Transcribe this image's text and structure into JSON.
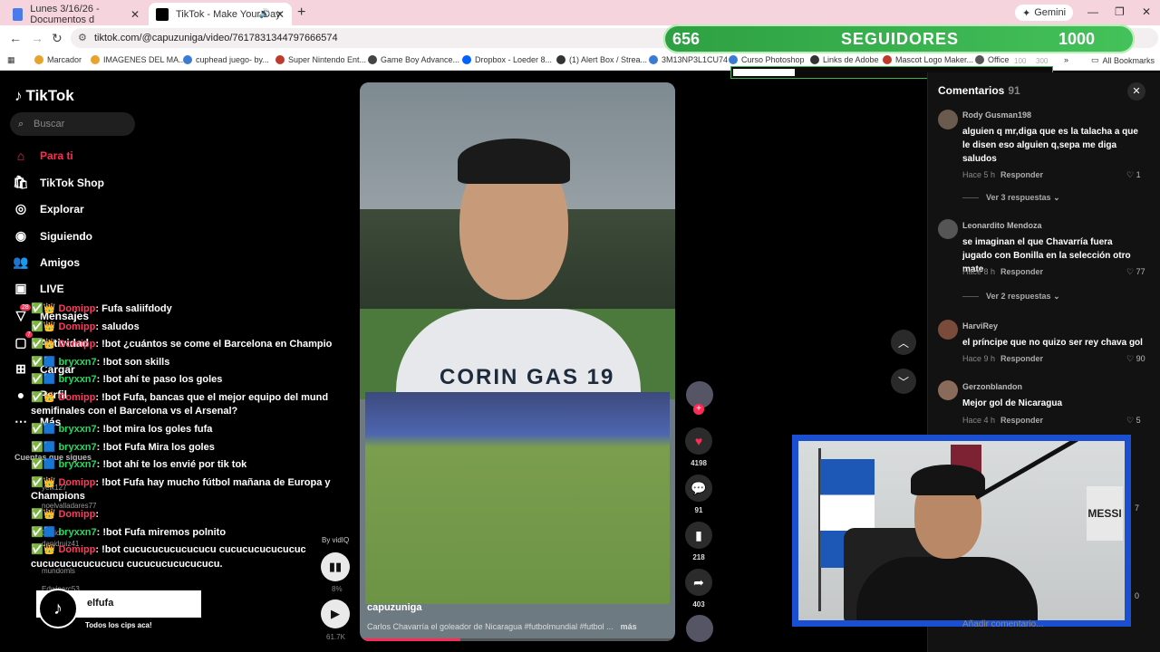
{
  "browser": {
    "tabs": [
      {
        "title": "Lunes 3/16/26 - Documentos d",
        "active": false
      },
      {
        "title": "TikTok - Make Your Day",
        "active": true
      }
    ],
    "gemini": "Gemini",
    "url": "tiktok.com/@capuzuniga/video/7617831344797666574",
    "bookmarks": [
      "Marcador",
      "IMAGENES DEL MA...",
      "cuphead juego- by...",
      "Super Nintendo Ent...",
      "Game Boy Advance...",
      "Dropbox - Loeder 8...",
      "(1) Alert Box / Strea...",
      "3M13NP3L1CU74",
      "Curso Photoshop",
      "Links de Adobe",
      "Mascot Logo Maker...",
      "Office",
      "All Bookmarks"
    ]
  },
  "follower_goal": {
    "current": "656",
    "label": "SEGUIDORES",
    "goal": "1000",
    "sub_left": "100",
    "sub_right": "300"
  },
  "tiktok": {
    "logo": "TikTok",
    "search_placeholder": "Buscar",
    "nav": [
      {
        "label": "Para ti",
        "icon": "home-icon",
        "active": true
      },
      {
        "label": "TikTok Shop",
        "icon": "shop-icon"
      },
      {
        "label": "Explorar",
        "icon": "compass-icon"
      },
      {
        "label": "Siguiendo",
        "icon": "following-icon"
      },
      {
        "label": "Amigos",
        "icon": "friends-icon"
      },
      {
        "label": "LIVE",
        "icon": "live-icon"
      },
      {
        "label": "Mensajes",
        "icon": "messages-icon"
      },
      {
        "label": "Actividad",
        "icon": "activity-icon"
      },
      {
        "label": "Cargar",
        "icon": "upload-icon"
      },
      {
        "label": "Perfil",
        "icon": "profile-icon"
      },
      {
        "label": "Más",
        "icon": "more-icon"
      }
    ],
    "following_header": "Cuentas que sigues",
    "following": [
      "yeik127",
      "noelvalladares77",
      "David",
      "danidruiz41",
      "mundomls",
      "Edwinarc53"
    ],
    "badge_messages": "28",
    "badge_activity": "7"
  },
  "chat": [
    {
      "user": "Domipp",
      "color": "red",
      "text": ": Fufa saliifdody"
    },
    {
      "user": "Domipp",
      "color": "red",
      "text": ": saludos"
    },
    {
      "user": "Domipp",
      "color": "red",
      "text": ": !bot ¿cuántos se come el Barcelona en Champio"
    },
    {
      "user": "bryxxn7",
      "color": "green",
      "text": ": !bot son skills"
    },
    {
      "user": "bryxxn7",
      "color": "green",
      "text": ": !bot ahí te paso los goles"
    },
    {
      "user": "Domipp",
      "color": "red",
      "text": ": !bot Fufa, bancas que el mejor equipo del mund"
    },
    {
      "user": "",
      "color": "none",
      "text": "semifinales con el Barcelona vs el Arsenal?"
    },
    {
      "user": "bryxxn7",
      "color": "green",
      "text": ": !bot mira los goles fufa"
    },
    {
      "user": "bryxxn7",
      "color": "green",
      "text": ": !bot Fufa Mira los goles"
    },
    {
      "user": "bryxxn7",
      "color": "green",
      "text": ": !bot ahí te los envié por tik tok"
    },
    {
      "user": "Domipp",
      "color": "red",
      "text": ": !bot Fufa hay mucho fútbol mañana de Europa y"
    },
    {
      "user": "",
      "color": "none",
      "text": "Champions"
    },
    {
      "user": "Domipp",
      "color": "red",
      "text": ":"
    },
    {
      "user": "bryxxn7",
      "color": "green",
      "text": ": !bot Fufa miremos polnito"
    },
    {
      "user": "Domipp",
      "color": "red",
      "text": ": !bot cucucucucucucucu cucucucucucucuc"
    },
    {
      "user": "",
      "color": "none",
      "text": "cucucucucucucucu cucucucucucucucu."
    }
  ],
  "video": {
    "jersey": "CORIN GAS 19",
    "author": "capuzuniga",
    "description": "Carlos Chavarría el goleador de Nicaragua #futbolmundial #futbol ...",
    "more": "más",
    "likes": "4198",
    "comments": "91",
    "saves": "218",
    "shares": "403",
    "progress": 0.32,
    "by": "By vidIQ",
    "volume": "8%",
    "views": "61.7K"
  },
  "comments_panel": {
    "title": "Comentarios",
    "count": "91",
    "reply_label": "Responder",
    "items": [
      {
        "user": "Rody Gusman198",
        "text": "alguien q mr,diga que es la talacha a que le disen eso alguien q,sepa me diga saludos",
        "time": "Hace 5 h",
        "likes": "1",
        "more": "Ver 3 respuestas"
      },
      {
        "user": "Leonardito Mendoza",
        "text": "se imaginan el que Chavarría fuera jugado con Bonilla en la selección otro mate",
        "time": "Hace 8 h",
        "likes": "77",
        "more": "Ver 2 respuestas"
      },
      {
        "user": "HarviRey",
        "text": "el príncipe que no quizo ser rey chava gol",
        "time": "Hace 9 h",
        "likes": "90",
        "more": ""
      },
      {
        "user": "Gerzonblandon",
        "text": "Mejor gol de Nicaragua",
        "time": "Hace 4 h",
        "likes": "5",
        "more": ""
      }
    ],
    "side_likes": [
      "7",
      "0"
    ],
    "input_placeholder": "Añadir comentario..."
  },
  "overlay": {
    "streamer_name": "elfufa",
    "subtitle": "Todos los cips aca!",
    "messi": "MESSI"
  }
}
